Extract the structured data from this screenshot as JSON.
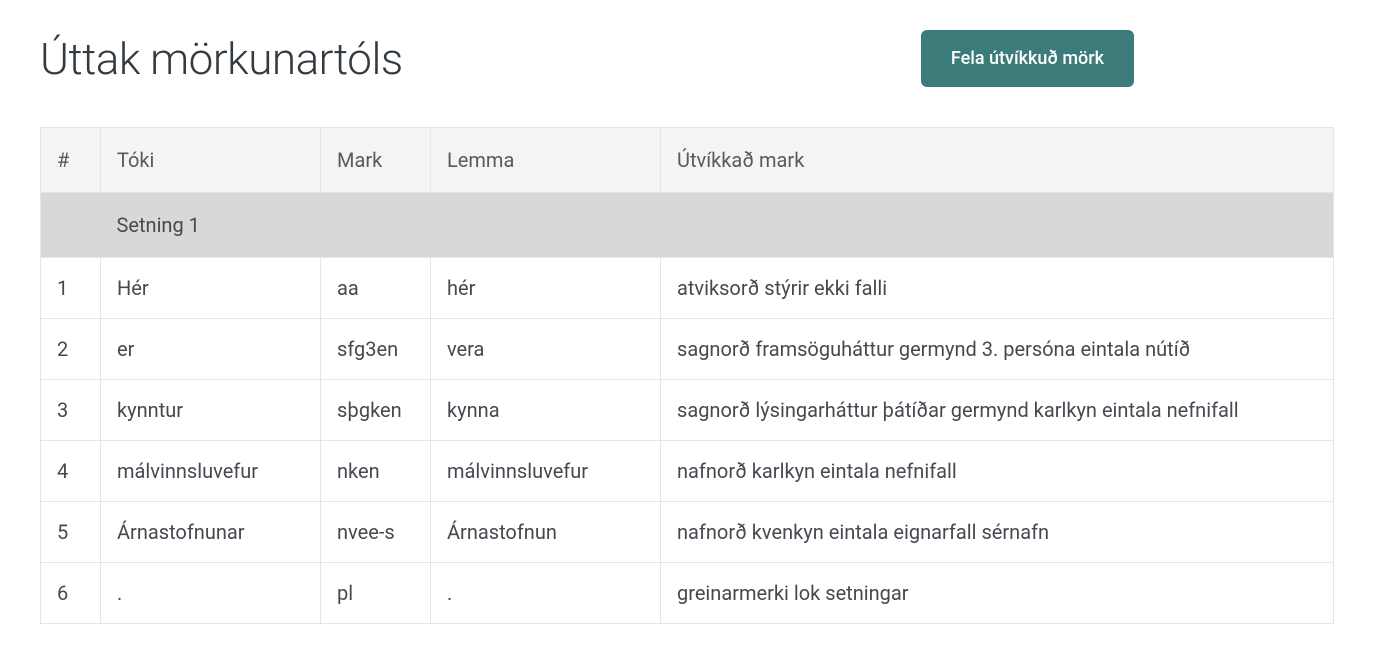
{
  "title": "Úttak mörkunartóls",
  "button_label": "Fela útvíkkuð mörk",
  "columns": {
    "num": "#",
    "toki": "Tóki",
    "mark": "Mark",
    "lemma": "Lemma",
    "extended": "Útvíkkað mark"
  },
  "section_label": "Setning 1",
  "rows": [
    {
      "n": "1",
      "toki": "Hér",
      "mark": "aa",
      "lemma": "hér",
      "ext": "atviksorð stýrir ekki falli"
    },
    {
      "n": "2",
      "toki": "er",
      "mark": "sfg3en",
      "lemma": "vera",
      "ext": "sagnorð framsöguháttur germynd 3. persóna eintala nútíð"
    },
    {
      "n": "3",
      "toki": "kynntur",
      "mark": "sþgken",
      "lemma": "kynna",
      "ext": "sagnorð lýsingarháttur þátíðar germynd karlkyn eintala nefnifall"
    },
    {
      "n": "4",
      "toki": "málvinnsluvefur",
      "mark": "nken",
      "lemma": "málvinnsluvefur",
      "ext": "nafnorð karlkyn eintala nefnifall"
    },
    {
      "n": "5",
      "toki": "Árnastofnunar",
      "mark": "nvee-s",
      "lemma": "Árnastofnun",
      "ext": "nafnorð kvenkyn eintala eignarfall sérnafn"
    },
    {
      "n": "6",
      "toki": ".",
      "mark": "pl",
      "lemma": ".",
      "ext": "greinarmerki lok setningar"
    }
  ]
}
